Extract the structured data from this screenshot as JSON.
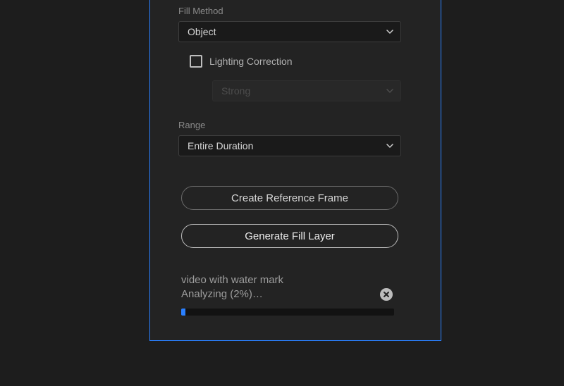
{
  "fill_method": {
    "label": "Fill Method",
    "value": "Object"
  },
  "lighting_correction": {
    "label": "Lighting Correction",
    "checked": false,
    "strength": "Strong"
  },
  "range": {
    "label": "Range",
    "value": "Entire Duration"
  },
  "buttons": {
    "create_reference": "Create Reference Frame",
    "generate_fill": "Generate Fill Layer"
  },
  "status": {
    "line1": "video with water mark",
    "line2": "Analyzing (2%)…",
    "progress_percent": 2
  },
  "colors": {
    "selection_border": "#2a80ff",
    "progress_fill": "#2a80ff"
  }
}
